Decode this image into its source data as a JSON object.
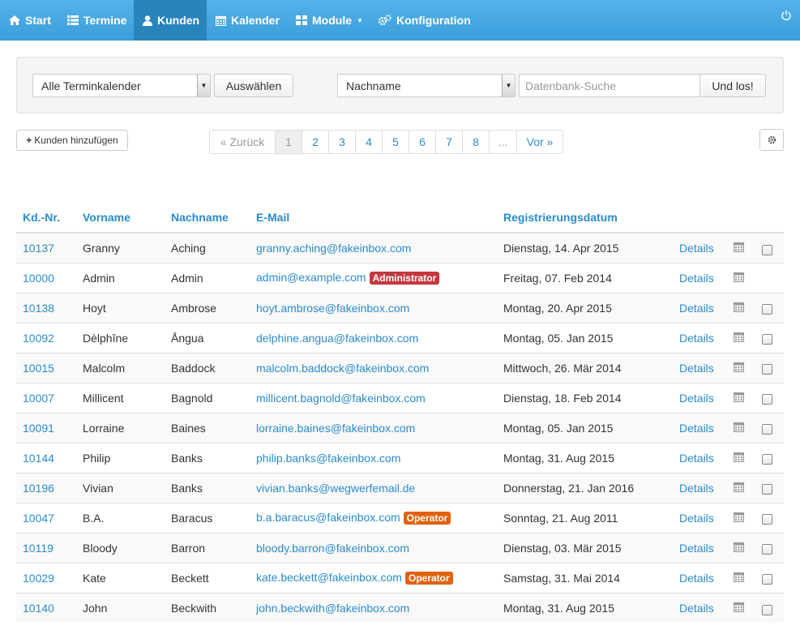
{
  "nav": {
    "items": [
      {
        "label": "Start",
        "icon": "home-icon"
      },
      {
        "label": "Termine",
        "icon": "list-icon"
      },
      {
        "label": "Kunden",
        "icon": "user-icon",
        "active": true
      },
      {
        "label": "Kalender",
        "icon": "calendar-icon"
      },
      {
        "label": "Module",
        "icon": "grid-icon",
        "dropdown": true
      },
      {
        "label": "Konfiguration",
        "icon": "cogs-icon"
      }
    ]
  },
  "filter": {
    "calendar_select": "Alle Terminkalender",
    "select_button": "Auswählen",
    "field_select": "Nachname",
    "search_placeholder": "Datenbank-Suche",
    "search_button": "Und los!"
  },
  "actions": {
    "add_customer": "Kunden hinzufügen"
  },
  "pagination": {
    "prev": "« Zurück",
    "pages": [
      "1",
      "2",
      "3",
      "4",
      "5",
      "6",
      "7",
      "8",
      "..."
    ],
    "current": "1",
    "next": "Vor »"
  },
  "table": {
    "headers": {
      "id": "Kd.-Nr.",
      "firstname": "Vorname",
      "lastname": "Nachname",
      "email": "E-Mail",
      "registered": "Registrierungsdatum"
    },
    "details_label": "Details",
    "rows": [
      {
        "id": "10137",
        "firstname": "Granny",
        "lastname": "Aching",
        "email": "granny.aching@fakeinbox.com",
        "badge": "",
        "date": "Dienstag, 14. Apr 2015",
        "checkbox": true
      },
      {
        "id": "10000",
        "firstname": "Admin",
        "lastname": "Admin",
        "email": "admin@example.com",
        "badge": "Administrator",
        "date": "Freitag, 07. Feb 2014",
        "checkbox": false
      },
      {
        "id": "10138",
        "firstname": "Hoyt",
        "lastname": "Ambrose",
        "email": "hoyt.ambrose@fakeinbox.com",
        "badge": "",
        "date": "Montag, 20. Apr 2015",
        "checkbox": true
      },
      {
        "id": "10092",
        "firstname": "Dèlphîne",
        "lastname": "Ångua",
        "email": "delphine.angua@fakeinbox.com",
        "badge": "",
        "date": "Montag, 05. Jan 2015",
        "checkbox": true
      },
      {
        "id": "10015",
        "firstname": "Malcolm",
        "lastname": "Baddock",
        "email": "malcolm.baddock@fakeinbox.com",
        "badge": "",
        "date": "Mittwoch, 26. Mär 2014",
        "checkbox": true
      },
      {
        "id": "10007",
        "firstname": "Millicent",
        "lastname": "Bagnold",
        "email": "millicent.bagnold@fakeinbox.com",
        "badge": "",
        "date": "Dienstag, 18. Feb 2014",
        "checkbox": true
      },
      {
        "id": "10091",
        "firstname": "Lorraine",
        "lastname": "Baines",
        "email": "lorraine.baines@fakeinbox.com",
        "badge": "",
        "date": "Montag, 05. Jan 2015",
        "checkbox": true
      },
      {
        "id": "10144",
        "firstname": "Philip",
        "lastname": "Banks",
        "email": "philip.banks@fakeinbox.com",
        "badge": "",
        "date": "Montag, 31. Aug 2015",
        "checkbox": true
      },
      {
        "id": "10196",
        "firstname": "Vivian",
        "lastname": "Banks",
        "email": "vivian.banks@wegwerfemail.de",
        "badge": "",
        "date": "Donnerstag, 21. Jan 2016",
        "checkbox": true
      },
      {
        "id": "10047",
        "firstname": "B.A.",
        "lastname": "Baracus",
        "email": "b.a.baracus@fakeinbox.com",
        "badge": "Operator",
        "date": "Sonntag, 21. Aug 2011",
        "checkbox": true
      },
      {
        "id": "10119",
        "firstname": "Bloody",
        "lastname": "Barron",
        "email": "bloody.barron@fakeinbox.com",
        "badge": "",
        "date": "Dienstag, 03. Mär 2015",
        "checkbox": true
      },
      {
        "id": "10029",
        "firstname": "Kate",
        "lastname": "Beckett",
        "email": "kate.beckett@fakeinbox.com",
        "badge": "Operator",
        "date": "Samstag, 31. Mai 2014",
        "checkbox": true
      },
      {
        "id": "10140",
        "firstname": "John",
        "lastname": "Beckwith",
        "email": "john.beckwith@fakeinbox.com",
        "badge": "",
        "date": "Montag, 31. Aug 2015",
        "checkbox": true
      }
    ]
  },
  "colors": {
    "navbar": "#3a9edb",
    "navbar_active": "#2a84bc",
    "link": "#2a8bcf",
    "badge_admin": "#c4383e",
    "badge_operator": "#e0620c"
  }
}
